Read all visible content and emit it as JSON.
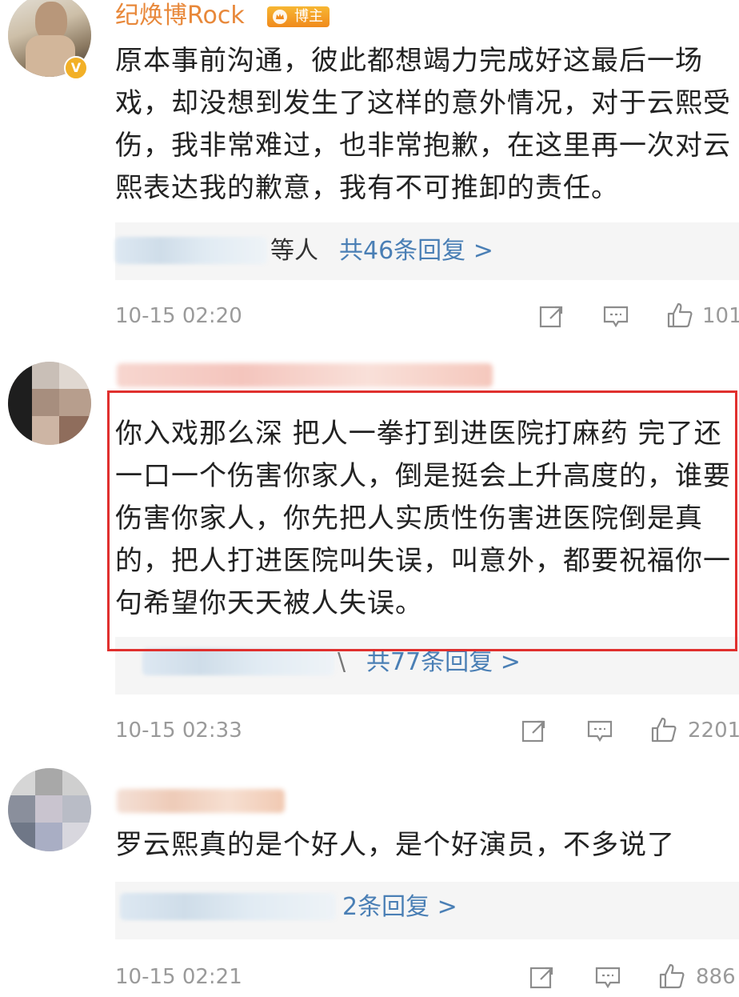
{
  "comments": [
    {
      "username": "纪焕博Rock",
      "badge": "博主",
      "text": "原本事前沟通，彼此都想竭力完成好这最后一场戏，却没想到发生了这样的意外情况，对于云熙受伤，我非常难过，也非常抱歉，在这里再一次对云熙表达我的歉意，我有不可推卸的责任。",
      "reply_others": "等人",
      "reply_link": "共46条回复 >",
      "time": "10-15 02:20",
      "likes": "101"
    },
    {
      "text": "你入戏那么深 把人一拳打到进医院打麻药 完了还一口一个伤害你家人，倒是挺会上升高度的，谁要伤害你家人，你先把人实质性伤害进医院倒是真的，把人打进医院叫失误，叫意外，都要祝福你一句希望你天天被人失误。",
      "reply_others": "\\",
      "reply_link": "共77条回复 >",
      "time": "10-15 02:33",
      "likes": "2201"
    },
    {
      "text": "罗云熙真的是个好人，是个好演员，不多说了",
      "reply_link": "2条回复 >",
      "time": "10-15 02:21",
      "likes": "886"
    }
  ],
  "icons": {
    "share": "share-icon",
    "comment": "comment-icon",
    "like": "thumbs-up-icon",
    "verified": "verified-v-icon"
  },
  "colors": {
    "username": "#e8883a",
    "link": "#4a7fb5",
    "meta": "#9a9a9a",
    "highlight": "#e0302e"
  }
}
